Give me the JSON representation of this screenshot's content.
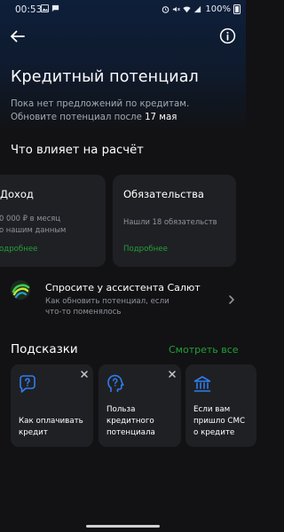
{
  "status_bar": {
    "time": "00:53",
    "left_icons": [
      "image-icon",
      "message-icon"
    ],
    "right_icons": [
      "alarm-icon",
      "mute-icon",
      "wifi-icon",
      "signal-icon"
    ],
    "battery": "100%"
  },
  "header": {
    "back_icon": "arrow-left-icon",
    "info_icon": "info-circle-icon"
  },
  "page": {
    "title": "Кредитный потенциал",
    "subtitle_line1": "Пока нет предложений по кредитам.",
    "subtitle_line2_prefix": "Обновите потенциал после ",
    "subtitle_date": "17 мая"
  },
  "factors": {
    "title": "Что влияет на расчёт",
    "income": {
      "title": "Доход",
      "line1": "0 000 ₽ в месяц",
      "line2": "о нашим данным",
      "link": "одробнее"
    },
    "obligations": {
      "title": "Обязательства",
      "body": "Нашли 18 обязательств",
      "link": "Подробнее"
    }
  },
  "assistant": {
    "title": "Спросите у ассистента Салют",
    "sub_line1": "Как обновить потенциал, если",
    "sub_line2": "что-то поменялось"
  },
  "hints": {
    "title": "Подсказки",
    "see_all": "Смотреть все",
    "items": [
      {
        "icon": "question-bubble-icon",
        "line1": "Как оплачивать",
        "line2": "кредит",
        "line3": ""
      },
      {
        "icon": "head-question-icon",
        "line1": "Польза",
        "line2": "кредитного",
        "line3": "потенциала"
      },
      {
        "icon": "bank-icon",
        "line1": "Если вам",
        "line2": "пришло СМС",
        "line3": "о кредите"
      }
    ]
  },
  "colors": {
    "accent_green": "#21a038",
    "icon_blue": "#2f7df0",
    "card_bg": "#1f2024",
    "page_bg": "#121214"
  }
}
